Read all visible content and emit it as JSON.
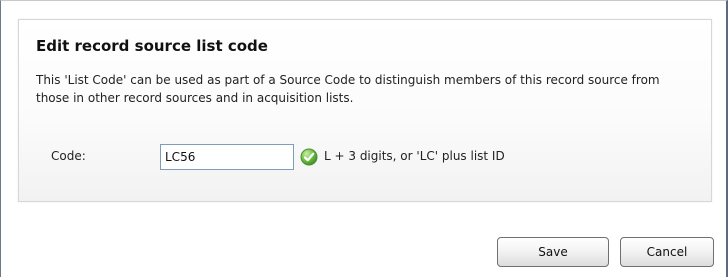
{
  "dialog": {
    "title": "Edit record source list code",
    "description": "This 'List Code' can be used as part of a Source Code to distinguish members of this record source from those in other record sources and in acquisition lists.",
    "code_label": "Code:",
    "code_value": "LC56",
    "validation_icon": "check-circle-icon",
    "code_hint": "L + 3 digits, or 'LC' plus list ID",
    "save_label": "Save",
    "cancel_label": "Cancel"
  },
  "colors": {
    "valid": "#5aa83a",
    "input_border": "#7f9db9",
    "button_border": "#707070"
  }
}
